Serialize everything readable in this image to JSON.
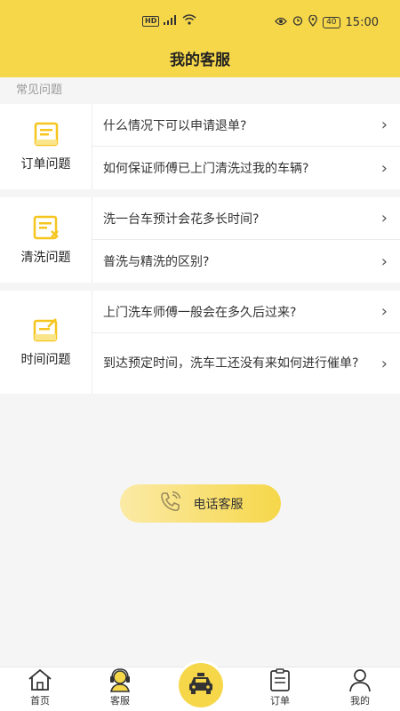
{
  "status": {
    "time": "15:00",
    "battery": "40"
  },
  "header": {
    "title": "我的客服"
  },
  "faq": {
    "section_title": "常见问题",
    "groups": [
      {
        "label": "订单问题",
        "icon": "order-doc-icon",
        "items": [
          "什么情况下可以申请退单?",
          "如何保证师傅已上门清洗过我的车辆?"
        ]
      },
      {
        "label": "清洗问题",
        "icon": "wash-doc-icon",
        "items": [
          "洗一台车预计会花多长时间?",
          "普洗与精洗的区别?"
        ]
      },
      {
        "label": "时间问题",
        "icon": "edit-doc-icon",
        "items": [
          "上门洗车师傅一般会在多久后过来?",
          "到达预定时间，洗车工还没有来如何进行催单?"
        ]
      }
    ]
  },
  "phone_button": {
    "label": "电话客服",
    "icon": "phone-icon"
  },
  "tabbar": {
    "tabs": [
      {
        "label": "首页",
        "icon": "home-icon"
      },
      {
        "label": "客服",
        "icon": "customer-service-icon"
      },
      {
        "label": "",
        "icon": "taxi-icon"
      },
      {
        "label": "订单",
        "icon": "clipboard-icon"
      },
      {
        "label": "我的",
        "icon": "person-icon"
      }
    ]
  },
  "colors": {
    "accent": "#f6d74a",
    "background": "#f5f5f5"
  }
}
